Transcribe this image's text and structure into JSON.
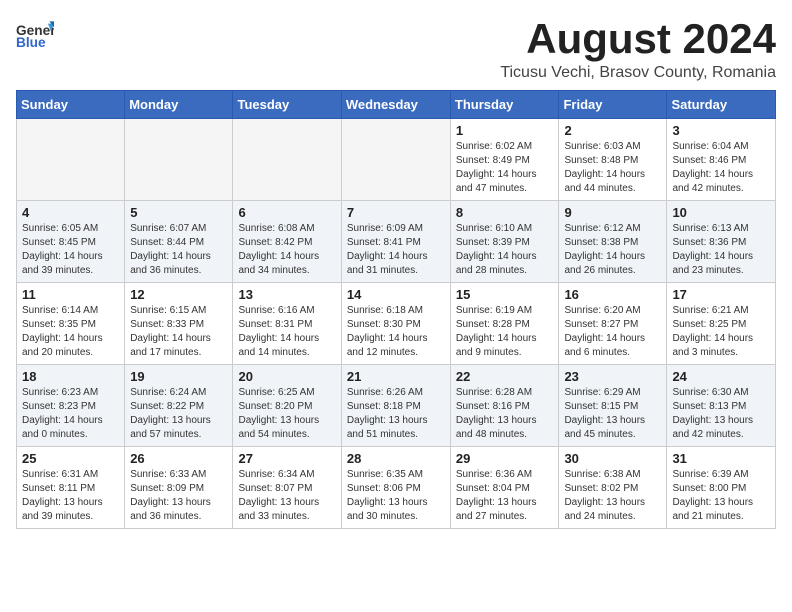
{
  "header": {
    "logo": {
      "general": "General",
      "blue": "Blue",
      "tagline": ""
    },
    "title": "August 2024",
    "location": "Ticusu Vechi, Brasov County, Romania"
  },
  "weekdays": [
    "Sunday",
    "Monday",
    "Tuesday",
    "Wednesday",
    "Thursday",
    "Friday",
    "Saturday"
  ],
  "weeks": [
    [
      {
        "day": "",
        "info": ""
      },
      {
        "day": "",
        "info": ""
      },
      {
        "day": "",
        "info": ""
      },
      {
        "day": "",
        "info": ""
      },
      {
        "day": "1",
        "info": "Sunrise: 6:02 AM\nSunset: 8:49 PM\nDaylight: 14 hours\nand 47 minutes."
      },
      {
        "day": "2",
        "info": "Sunrise: 6:03 AM\nSunset: 8:48 PM\nDaylight: 14 hours\nand 44 minutes."
      },
      {
        "day": "3",
        "info": "Sunrise: 6:04 AM\nSunset: 8:46 PM\nDaylight: 14 hours\nand 42 minutes."
      }
    ],
    [
      {
        "day": "4",
        "info": "Sunrise: 6:05 AM\nSunset: 8:45 PM\nDaylight: 14 hours\nand 39 minutes."
      },
      {
        "day": "5",
        "info": "Sunrise: 6:07 AM\nSunset: 8:44 PM\nDaylight: 14 hours\nand 36 minutes."
      },
      {
        "day": "6",
        "info": "Sunrise: 6:08 AM\nSunset: 8:42 PM\nDaylight: 14 hours\nand 34 minutes."
      },
      {
        "day": "7",
        "info": "Sunrise: 6:09 AM\nSunset: 8:41 PM\nDaylight: 14 hours\nand 31 minutes."
      },
      {
        "day": "8",
        "info": "Sunrise: 6:10 AM\nSunset: 8:39 PM\nDaylight: 14 hours\nand 28 minutes."
      },
      {
        "day": "9",
        "info": "Sunrise: 6:12 AM\nSunset: 8:38 PM\nDaylight: 14 hours\nand 26 minutes."
      },
      {
        "day": "10",
        "info": "Sunrise: 6:13 AM\nSunset: 8:36 PM\nDaylight: 14 hours\nand 23 minutes."
      }
    ],
    [
      {
        "day": "11",
        "info": "Sunrise: 6:14 AM\nSunset: 8:35 PM\nDaylight: 14 hours\nand 20 minutes."
      },
      {
        "day": "12",
        "info": "Sunrise: 6:15 AM\nSunset: 8:33 PM\nDaylight: 14 hours\nand 17 minutes."
      },
      {
        "day": "13",
        "info": "Sunrise: 6:16 AM\nSunset: 8:31 PM\nDaylight: 14 hours\nand 14 minutes."
      },
      {
        "day": "14",
        "info": "Sunrise: 6:18 AM\nSunset: 8:30 PM\nDaylight: 14 hours\nand 12 minutes."
      },
      {
        "day": "15",
        "info": "Sunrise: 6:19 AM\nSunset: 8:28 PM\nDaylight: 14 hours\nand 9 minutes."
      },
      {
        "day": "16",
        "info": "Sunrise: 6:20 AM\nSunset: 8:27 PM\nDaylight: 14 hours\nand 6 minutes."
      },
      {
        "day": "17",
        "info": "Sunrise: 6:21 AM\nSunset: 8:25 PM\nDaylight: 14 hours\nand 3 minutes."
      }
    ],
    [
      {
        "day": "18",
        "info": "Sunrise: 6:23 AM\nSunset: 8:23 PM\nDaylight: 14 hours\nand 0 minutes."
      },
      {
        "day": "19",
        "info": "Sunrise: 6:24 AM\nSunset: 8:22 PM\nDaylight: 13 hours\nand 57 minutes."
      },
      {
        "day": "20",
        "info": "Sunrise: 6:25 AM\nSunset: 8:20 PM\nDaylight: 13 hours\nand 54 minutes."
      },
      {
        "day": "21",
        "info": "Sunrise: 6:26 AM\nSunset: 8:18 PM\nDaylight: 13 hours\nand 51 minutes."
      },
      {
        "day": "22",
        "info": "Sunrise: 6:28 AM\nSunset: 8:16 PM\nDaylight: 13 hours\nand 48 minutes."
      },
      {
        "day": "23",
        "info": "Sunrise: 6:29 AM\nSunset: 8:15 PM\nDaylight: 13 hours\nand 45 minutes."
      },
      {
        "day": "24",
        "info": "Sunrise: 6:30 AM\nSunset: 8:13 PM\nDaylight: 13 hours\nand 42 minutes."
      }
    ],
    [
      {
        "day": "25",
        "info": "Sunrise: 6:31 AM\nSunset: 8:11 PM\nDaylight: 13 hours\nand 39 minutes."
      },
      {
        "day": "26",
        "info": "Sunrise: 6:33 AM\nSunset: 8:09 PM\nDaylight: 13 hours\nand 36 minutes."
      },
      {
        "day": "27",
        "info": "Sunrise: 6:34 AM\nSunset: 8:07 PM\nDaylight: 13 hours\nand 33 minutes."
      },
      {
        "day": "28",
        "info": "Sunrise: 6:35 AM\nSunset: 8:06 PM\nDaylight: 13 hours\nand 30 minutes."
      },
      {
        "day": "29",
        "info": "Sunrise: 6:36 AM\nSunset: 8:04 PM\nDaylight: 13 hours\nand 27 minutes."
      },
      {
        "day": "30",
        "info": "Sunrise: 6:38 AM\nSunset: 8:02 PM\nDaylight: 13 hours\nand 24 minutes."
      },
      {
        "day": "31",
        "info": "Sunrise: 6:39 AM\nSunset: 8:00 PM\nDaylight: 13 hours\nand 21 minutes."
      }
    ]
  ]
}
